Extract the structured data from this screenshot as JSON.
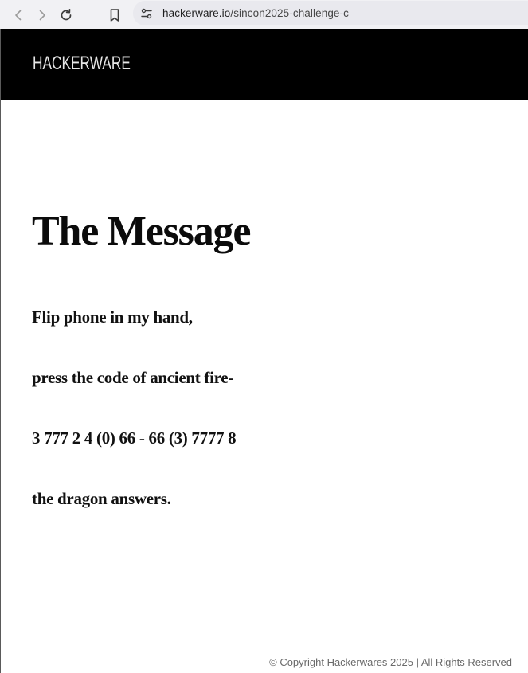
{
  "browser": {
    "url_host": "hackerware.io",
    "url_path": "/sincon2025-challenge-c"
  },
  "header": {
    "logo_text": "HACKERWARE"
  },
  "main": {
    "title": "The Message",
    "lines": [
      "Flip phone in my hand,",
      "press the code of ancient fire-",
      "3 777 2 4 (0) 66 - 66 (3) 7777 8",
      "the dragon answers."
    ]
  },
  "footer": {
    "copyright": "© Copyright Hackerwares 2025 | All Rights Reserved"
  }
}
